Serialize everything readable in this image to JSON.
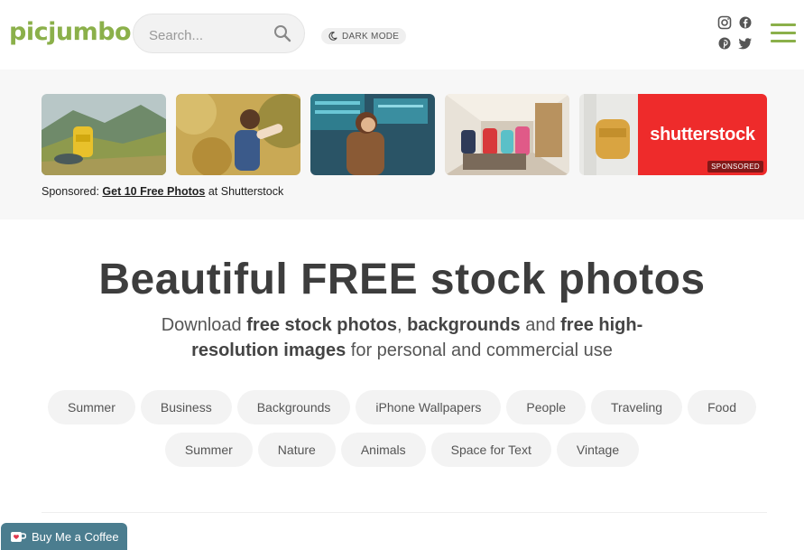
{
  "header": {
    "logo": "picjumbo",
    "search_placeholder": "Search...",
    "dark_mode_label": "DARK MODE",
    "social_icons": [
      "instagram-icon",
      "facebook-icon",
      "pinterest-icon",
      "twitter-icon"
    ],
    "accent_color": "#8bb04a"
  },
  "sponsored": {
    "prefix": "Sponsored:",
    "link_text": "Get 10 Free Photos",
    "suffix": "at Shutterstock",
    "shutterstock_logo": "shutterstock",
    "badge": "SPONSORED"
  },
  "hero": {
    "title": "Beautiful FREE stock photos",
    "sub_part1": "Download ",
    "sub_bold1": "free stock photos",
    "sub_part2": ", ",
    "sub_bold2": "backgrounds",
    "sub_part3": " and ",
    "sub_bold3": "free high-resolution images",
    "sub_part4": " for personal and commercial use"
  },
  "tags_row1": [
    "Summer",
    "Business",
    "Backgrounds",
    "iPhone Wallpapers",
    "People",
    "Traveling",
    "Food"
  ],
  "tags_row2": [
    "Summer",
    "Nature",
    "Animals",
    "Space for Text",
    "Vintage"
  ],
  "buy_coffee": "Buy Me a Coffee"
}
